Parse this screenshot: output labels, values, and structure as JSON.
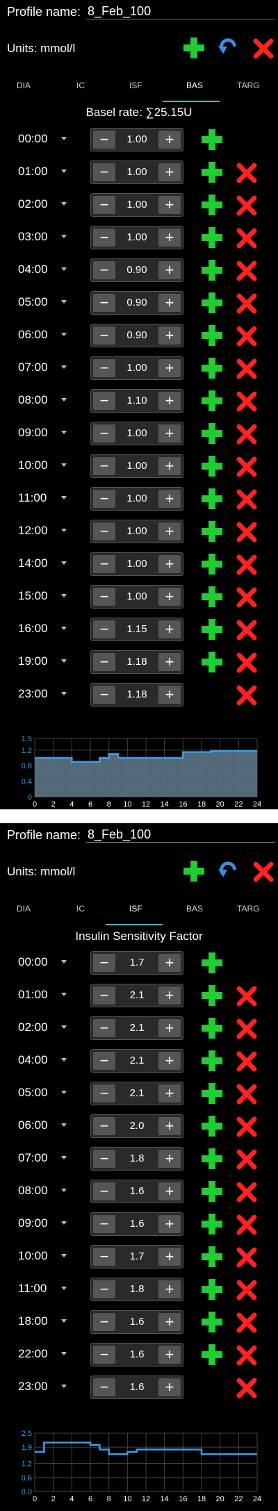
{
  "screens": [
    {
      "profile_label": "Profile name:",
      "profile_name": "8_Feb_100",
      "units": "Units: mmol/l",
      "tabs": [
        "DIA",
        "IC",
        "ISF",
        "BAS",
        "TARG"
      ],
      "active_tab": "BAS",
      "section_title": "Basel rate:  ∑25.15U",
      "rows": [
        {
          "time": "00:00",
          "value": "1.00",
          "add": true,
          "del": false
        },
        {
          "time": "01:00",
          "value": "1.00",
          "add": true,
          "del": true
        },
        {
          "time": "02:00",
          "value": "1.00",
          "add": true,
          "del": true
        },
        {
          "time": "03:00",
          "value": "1.00",
          "add": true,
          "del": true
        },
        {
          "time": "04:00",
          "value": "0.90",
          "add": true,
          "del": true
        },
        {
          "time": "05:00",
          "value": "0.90",
          "add": true,
          "del": true
        },
        {
          "time": "06:00",
          "value": "0.90",
          "add": true,
          "del": true
        },
        {
          "time": "07:00",
          "value": "1.00",
          "add": true,
          "del": true
        },
        {
          "time": "08:00",
          "value": "1.10",
          "add": true,
          "del": true
        },
        {
          "time": "09:00",
          "value": "1.00",
          "add": true,
          "del": true
        },
        {
          "time": "10:00",
          "value": "1.00",
          "add": true,
          "del": true
        },
        {
          "time": "11:00",
          "value": "1.00",
          "add": true,
          "del": true
        },
        {
          "time": "12:00",
          "value": "1.00",
          "add": true,
          "del": true
        },
        {
          "time": "14:00",
          "value": "1.00",
          "add": true,
          "del": true
        },
        {
          "time": "15:00",
          "value": "1.00",
          "add": true,
          "del": true
        },
        {
          "time": "16:00",
          "value": "1.15",
          "add": true,
          "del": true
        },
        {
          "time": "19:00",
          "value": "1.18",
          "add": true,
          "del": true
        },
        {
          "time": "23:00",
          "value": "1.18",
          "add": false,
          "del": true
        }
      ],
      "chart": {
        "type": "area",
        "x_ticks": [
          "0",
          "2",
          "4",
          "6",
          "8",
          "10",
          "12",
          "14",
          "16",
          "18",
          "20",
          "22",
          "24"
        ],
        "y_ticks": [
          "1.5",
          "1.2",
          "0.8",
          "0.4",
          "0"
        ],
        "ylim": [
          0,
          1.5
        ],
        "steps": [
          [
            0,
            1.0
          ],
          [
            4,
            0.9
          ],
          [
            7,
            1.0
          ],
          [
            8,
            1.1
          ],
          [
            9,
            1.0
          ],
          [
            16,
            1.15
          ],
          [
            19,
            1.18
          ],
          [
            24,
            1.18
          ]
        ]
      }
    },
    {
      "profile_label": "Profile name:",
      "profile_name": "8_Feb_100",
      "units": "Units: mmol/l",
      "tabs": [
        "DIA",
        "IC",
        "ISF",
        "BAS",
        "TARG"
      ],
      "active_tab": "ISF",
      "section_title": "Insulin Sensitivity Factor",
      "rows": [
        {
          "time": "00:00",
          "value": "1.7",
          "add": true,
          "del": false
        },
        {
          "time": "01:00",
          "value": "2.1",
          "add": true,
          "del": true
        },
        {
          "time": "02:00",
          "value": "2.1",
          "add": true,
          "del": true
        },
        {
          "time": "04:00",
          "value": "2.1",
          "add": true,
          "del": true
        },
        {
          "time": "05:00",
          "value": "2.1",
          "add": true,
          "del": true
        },
        {
          "time": "06:00",
          "value": "2.0",
          "add": true,
          "del": true
        },
        {
          "time": "07:00",
          "value": "1.8",
          "add": true,
          "del": true
        },
        {
          "time": "08:00",
          "value": "1.6",
          "add": true,
          "del": true
        },
        {
          "time": "09:00",
          "value": "1.6",
          "add": true,
          "del": true
        },
        {
          "time": "10:00",
          "value": "1.7",
          "add": true,
          "del": true
        },
        {
          "time": "11:00",
          "value": "1.8",
          "add": true,
          "del": true
        },
        {
          "time": "18:00",
          "value": "1.6",
          "add": true,
          "del": true
        },
        {
          "time": "22:00",
          "value": "1.6",
          "add": true,
          "del": true
        },
        {
          "time": "23:00",
          "value": "1.6",
          "add": false,
          "del": true
        }
      ],
      "chart": {
        "type": "line",
        "x_ticks": [
          "0",
          "2",
          "4",
          "6",
          "8",
          "10",
          "12",
          "14",
          "16",
          "18",
          "20",
          "22",
          "24"
        ],
        "y_ticks": [
          "2.5",
          "1.9",
          "1.2",
          "0.6",
          "0.0"
        ],
        "ylim": [
          0,
          2.5
        ],
        "steps": [
          [
            0,
            1.7
          ],
          [
            1,
            2.1
          ],
          [
            6,
            2.0
          ],
          [
            7,
            1.8
          ],
          [
            8,
            1.6
          ],
          [
            10,
            1.7
          ],
          [
            11,
            1.8
          ],
          [
            18,
            1.6
          ],
          [
            24,
            1.6
          ]
        ]
      }
    }
  ],
  "colors": {
    "background": "#000000",
    "add": "#22cc33",
    "delete": "#ff2222",
    "undo": "#3a8ee6",
    "accent": "#2ec4c4",
    "chart_line": "#3aa0e8"
  },
  "icons": {
    "add": "plus-icon",
    "undo": "undo-icon",
    "delete": "close-icon"
  },
  "stepper": {
    "minus": "−",
    "plus": "+"
  }
}
